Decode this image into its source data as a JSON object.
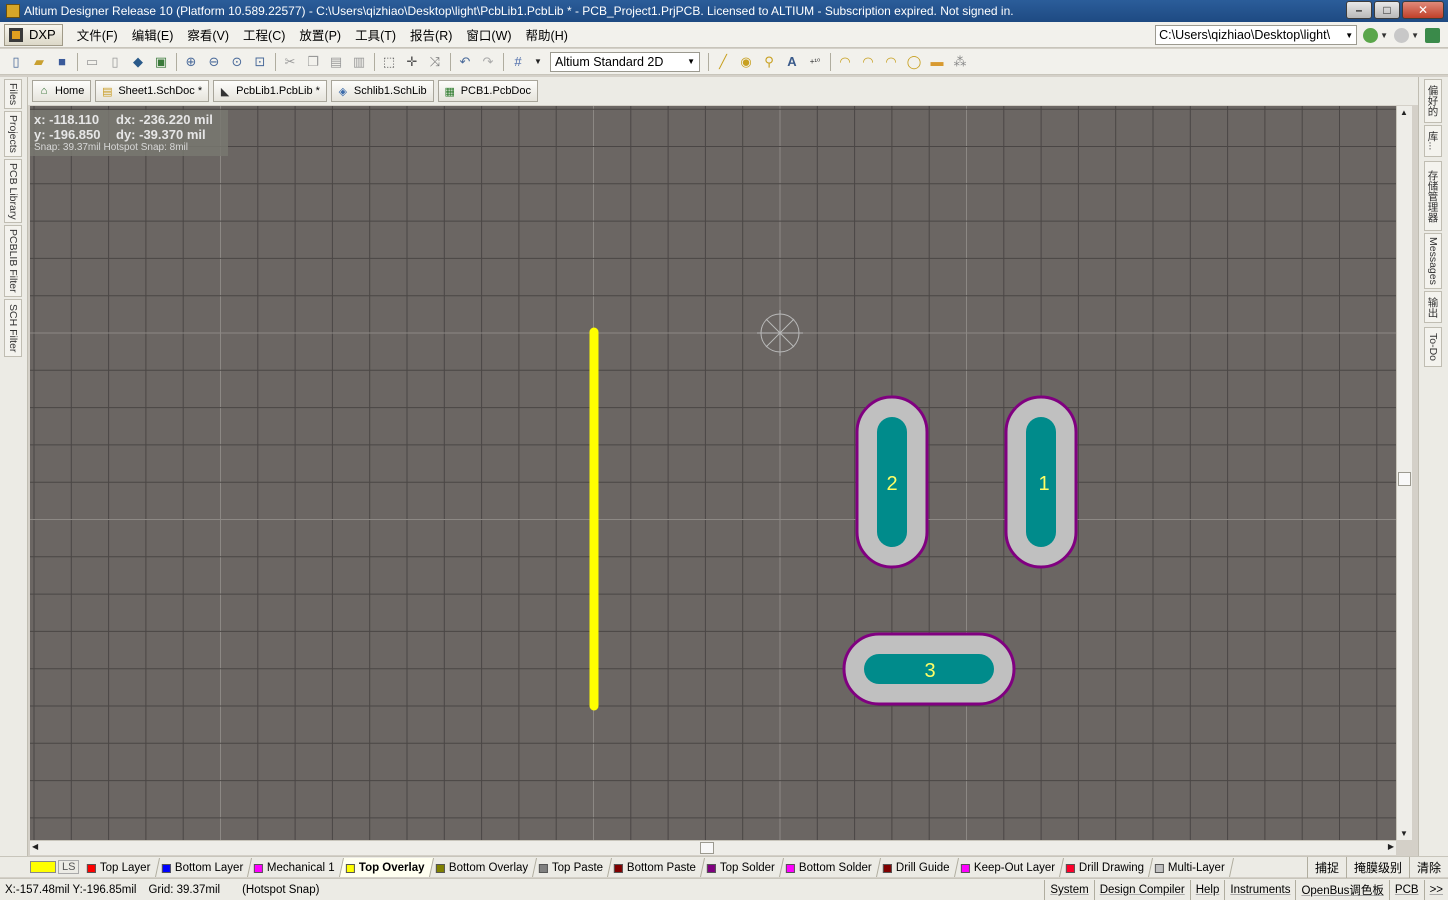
{
  "window": {
    "title": "Altium Designer Release 10 (Platform 10.589.22577) - C:\\Users\\qizhiao\\Desktop\\light\\PcbLib1.PcbLib * - PCB_Project1.PrjPCB. Licensed to ALTIUM - Subscription expired. Not signed in."
  },
  "menu": {
    "dxp": "DXP",
    "items": [
      "文件(F)",
      "编辑(E)",
      "察看(V)",
      "工程(C)",
      "放置(P)",
      "工具(T)",
      "报告(R)",
      "窗口(W)",
      "帮助(H)"
    ],
    "path": "C:\\Users\\qizhiao\\Desktop\\light\\"
  },
  "toolbar": {
    "view_mode": "Altium Standard 2D",
    "icons_left": [
      "new-icon",
      "open-icon",
      "save-icon",
      "print-icon",
      "print-preview-icon",
      "layers-icon",
      "board-icon",
      "zoom-in-icon",
      "zoom-out-icon",
      "zoom-fit-icon",
      "zoom-selection-icon",
      "cut-icon",
      "copy-icon",
      "paste-icon",
      "rubber-stamp-icon",
      "select-area-icon",
      "move-icon",
      "deselect-icon",
      "undo-icon",
      "redo-icon",
      "grid-icon"
    ],
    "icons_right": [
      "line-icon",
      "pad-icon",
      "via-icon",
      "string-icon",
      "coordinate-icon",
      "arc-center-icon",
      "arc-edge-icon",
      "arc-any-icon",
      "full-circle-icon",
      "fill-icon",
      "array-paste-icon"
    ]
  },
  "doc_tabs": [
    {
      "label": "Home",
      "icon": "home-icon"
    },
    {
      "label": "Sheet1.SchDoc *",
      "icon": "schdoc-icon"
    },
    {
      "label": "PcbLib1.PcbLib *",
      "icon": "pcblib-icon"
    },
    {
      "label": "Schlib1.SchLib",
      "icon": "schlib-icon"
    },
    {
      "label": "PCB1.PcbDoc",
      "icon": "pcbdoc-icon"
    }
  ],
  "left_panels": [
    "Files",
    "Projects",
    "PCB Library",
    "PCBLIB Filter",
    "SCH Filter"
  ],
  "right_panels": [
    "偏好的",
    "库...",
    "存储管理器",
    "Messages",
    "输出",
    "To-Do"
  ],
  "hud": {
    "x": "x:  -118.110",
    "dx": "dx:  -236.220  mil",
    "y": "y:  -196.850",
    "dy": "dy:   -39.370  mil",
    "snap": "Snap: 39.37mil Hotspot Snap: 8mil"
  },
  "canvas": {
    "background": "#6b6663",
    "grid_color": "#4a4645",
    "overlay_line_color": "#ffff00",
    "pad_outline_color": "#800080",
    "pad_mask_color": "#c0c0c0",
    "pad_copper_color": "#008b8b",
    "pads": [
      {
        "designator": "2",
        "orientation": "vertical"
      },
      {
        "designator": "1",
        "orientation": "vertical"
      },
      {
        "designator": "3",
        "orientation": "horizontal"
      }
    ]
  },
  "layers": {
    "ls_label": "LS",
    "tabs": [
      {
        "name": "Top Layer",
        "color": "#ff0000"
      },
      {
        "name": "Bottom Layer",
        "color": "#0000ff"
      },
      {
        "name": "Mechanical 1",
        "color": "#ff00ff"
      },
      {
        "name": "Top Overlay",
        "color": "#ffff00",
        "active": true
      },
      {
        "name": "Bottom Overlay",
        "color": "#808000"
      },
      {
        "name": "Top Paste",
        "color": "#808080"
      },
      {
        "name": "Bottom Paste",
        "color": "#800000"
      },
      {
        "name": "Top Solder",
        "color": "#800080"
      },
      {
        "name": "Bottom Solder",
        "color": "#ff00ff"
      },
      {
        "name": "Drill Guide",
        "color": "#800000"
      },
      {
        "name": "Keep-Out Layer",
        "color": "#ff00ff"
      },
      {
        "name": "Drill Drawing",
        "color": "#ff002a"
      },
      {
        "name": "Multi-Layer",
        "color": "#c0c0c0"
      }
    ],
    "right": [
      "捕捉",
      "掩膜级别",
      "清除"
    ]
  },
  "status": {
    "coords": "X:-157.48mil Y:-196.85mil",
    "grid": "Grid: 39.37mil",
    "snap": "(Hotspot Snap)",
    "right": [
      "System",
      "Design Compiler",
      "Help",
      "Instruments",
      "OpenBus调色板",
      "PCB",
      ">>"
    ]
  }
}
